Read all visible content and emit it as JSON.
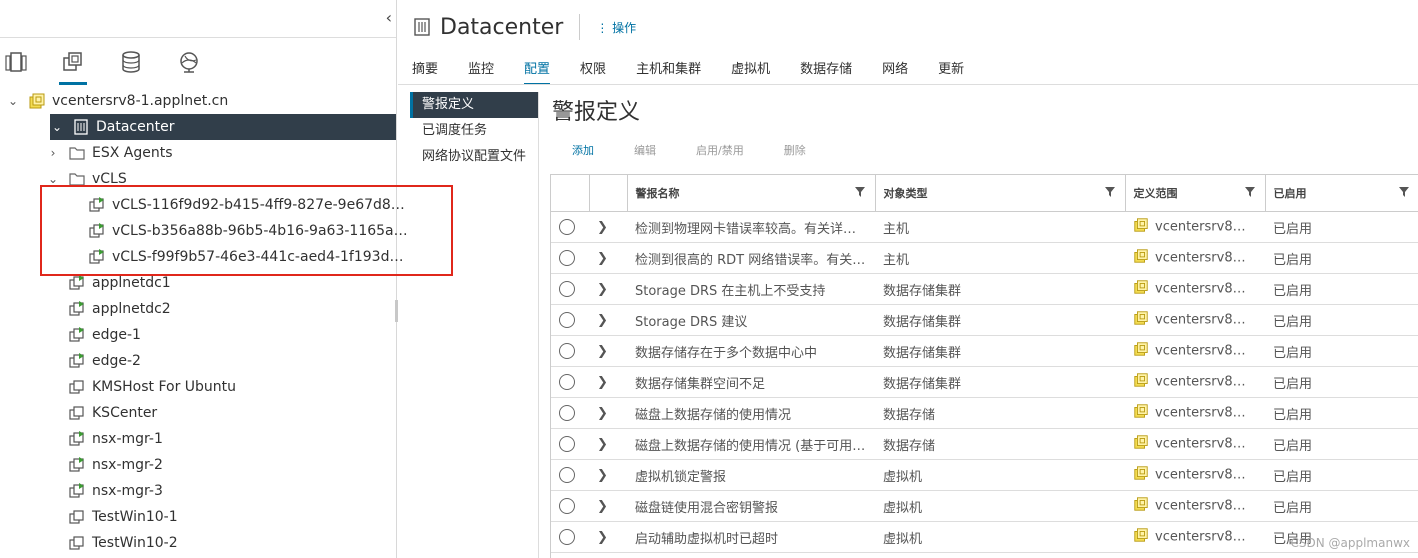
{
  "nav": {
    "collapse_icon": "‹",
    "tabs": [
      {
        "name": "hosts-clusters-icon"
      },
      {
        "name": "vms-templates-icon"
      },
      {
        "name": "storage-icon"
      },
      {
        "name": "networking-icon"
      }
    ]
  },
  "tree": [
    {
      "label": "vcentersrv8-1.applnet.cn",
      "toggle": "⌄",
      "icon": "vcenter"
    },
    {
      "label": "Datacenter",
      "toggle": "⌄",
      "icon": "datacenter"
    },
    {
      "label": "ESX Agents",
      "toggle": "›",
      "icon": "folder"
    },
    {
      "label": "vCLS",
      "toggle": "⌄",
      "icon": "folder"
    },
    {
      "label": "vCLS-116f9d92-b415-4ff9-827e-9e67d8…",
      "toggle": "",
      "icon": "vm-on"
    },
    {
      "label": "vCLS-b356a88b-96b5-4b16-9a63-1165a…",
      "toggle": "",
      "icon": "vm-on"
    },
    {
      "label": "vCLS-f99f9b57-46e3-441c-aed4-1f193d…",
      "toggle": "",
      "icon": "vm-on"
    },
    {
      "label": "applnetdc1",
      "toggle": "",
      "icon": "vm-on"
    },
    {
      "label": "applnetdc2",
      "toggle": "",
      "icon": "vm-on"
    },
    {
      "label": "edge-1",
      "toggle": "",
      "icon": "vm-on"
    },
    {
      "label": "edge-2",
      "toggle": "",
      "icon": "vm-on"
    },
    {
      "label": "KMSHost For Ubuntu",
      "toggle": "",
      "icon": "vm-off"
    },
    {
      "label": "KSCenter",
      "toggle": "",
      "icon": "vm-off"
    },
    {
      "label": "nsx-mgr-1",
      "toggle": "",
      "icon": "vm-on"
    },
    {
      "label": "nsx-mgr-2",
      "toggle": "",
      "icon": "vm-on"
    },
    {
      "label": "nsx-mgr-3",
      "toggle": "",
      "icon": "vm-on"
    },
    {
      "label": "TestWin10-1",
      "toggle": "",
      "icon": "vm-off"
    },
    {
      "label": "TestWin10-2",
      "toggle": "",
      "icon": "vm-off"
    }
  ],
  "header": {
    "title": "Datacenter",
    "actions_label": "操作",
    "actions_icon": "⋮"
  },
  "tabs": [
    "摘要",
    "监控",
    "配置",
    "权限",
    "主机和集群",
    "虚拟机",
    "数据存储",
    "网络",
    "更新"
  ],
  "active_tab": "配置",
  "subnav": [
    "警报定义",
    "已调度任务",
    "网络协议配置文件"
  ],
  "content": {
    "title": "警报定义",
    "actions": [
      {
        "label": "添加",
        "enabled": true
      },
      {
        "label": "编辑",
        "enabled": false
      },
      {
        "label": "启用/禁用",
        "enabled": false
      },
      {
        "label": "删除",
        "enabled": false
      }
    ],
    "columns": [
      "警报名称",
      "对象类型",
      "定义范围",
      "已启用"
    ],
    "rows": [
      {
        "name": "检测到物理网卡错误率较高。有关详…",
        "type": "主机",
        "scope": "vcentersrv8…",
        "enabled": "已启用"
      },
      {
        "name": "检测到很高的 RDT 网络错误率。有关…",
        "type": "主机",
        "scope": "vcentersrv8…",
        "enabled": "已启用"
      },
      {
        "name": "Storage DRS 在主机上不受支持",
        "type": "数据存储集群",
        "scope": "vcentersrv8…",
        "enabled": "已启用"
      },
      {
        "name": "Storage DRS 建议",
        "type": "数据存储集群",
        "scope": "vcentersrv8…",
        "enabled": "已启用"
      },
      {
        "name": "数据存储存在于多个数据中心中",
        "type": "数据存储集群",
        "scope": "vcentersrv8…",
        "enabled": "已启用"
      },
      {
        "name": "数据存储集群空间不足",
        "type": "数据存储集群",
        "scope": "vcentersrv8…",
        "enabled": "已启用"
      },
      {
        "name": "磁盘上数据存储的使用情况",
        "type": "数据存储",
        "scope": "vcentersrv8…",
        "enabled": "已启用"
      },
      {
        "name": "磁盘上数据存储的使用情况 (基于可用…",
        "type": "数据存储",
        "scope": "vcentersrv8…",
        "enabled": "已启用"
      },
      {
        "name": "虚拟机锁定警报",
        "type": "虚拟机",
        "scope": "vcentersrv8…",
        "enabled": "已启用"
      },
      {
        "name": "磁盘链使用混合密钥警报",
        "type": "虚拟机",
        "scope": "vcentersrv8…",
        "enabled": "已启用"
      },
      {
        "name": "启动辅助虚拟机时已超时",
        "type": "虚拟机",
        "scope": "vcentersrv8…",
        "enabled": "已启用"
      }
    ]
  },
  "watermark": "CSDN @applmanwx",
  "colors": {
    "accent": "#0072a3",
    "selected_bg": "#313e4a",
    "highlight_box": "#e0271b",
    "vm_on": "#3d9b35",
    "vcenter": "#e0c22a"
  }
}
